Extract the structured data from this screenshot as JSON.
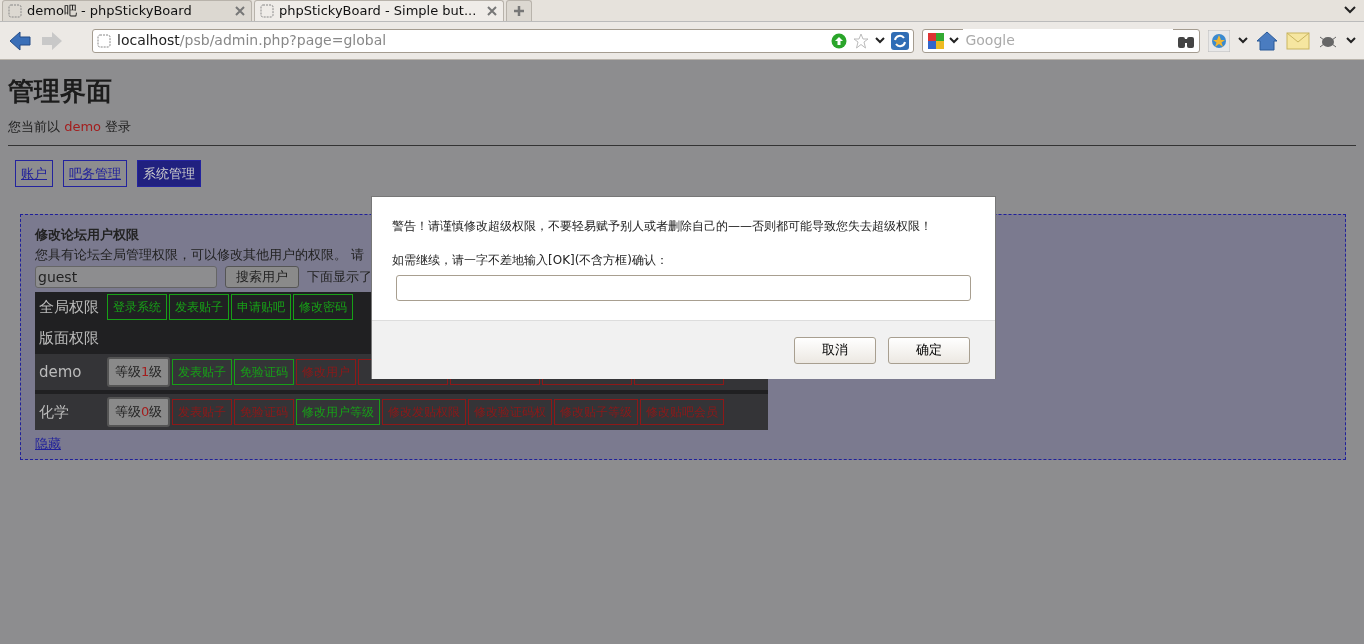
{
  "browser": {
    "tabs": [
      {
        "title": "demo吧 - phpStickyBoard",
        "selected": false
      },
      {
        "title": "phpStickyBoard - Simple but...",
        "selected": true
      }
    ],
    "url": {
      "host": "localhost",
      "path": "/psb/admin.php?page=global"
    },
    "search": {
      "placeholder": "Google"
    }
  },
  "page": {
    "title": "管理界面",
    "login": {
      "prefix": "您当前以",
      "user": "demo",
      "suffix": "登录"
    },
    "nav": [
      {
        "label": "账户",
        "selected": false
      },
      {
        "label": "吧务管理",
        "selected": false
      },
      {
        "label": "系统管理",
        "selected": true
      }
    ],
    "panel": {
      "title": "修改论坛用户权限",
      "description": "您具有论坛全局管理权限，可以修改其他用户的权限。 请",
      "search": {
        "value": "guest",
        "button": "搜索用户"
      },
      "note": "下面显示了",
      "global": {
        "label": "全局权限",
        "cells": [
          {
            "label": "登录系统",
            "granted": true
          },
          {
            "label": "发表贴子",
            "granted": true
          },
          {
            "label": "申请贴吧",
            "granted": true
          },
          {
            "label": "修改密码",
            "granted": true
          }
        ]
      },
      "board_header": "版面权限",
      "users": [
        {
          "name": "demo",
          "grade_prefix": "等级",
          "grade": "1",
          "grade_suffix": "级",
          "cells": [
            {
              "label": "发表贴子",
              "granted": true
            },
            {
              "label": "免验证码",
              "granted": true
            },
            {
              "label": "修改用户",
              "granted": false
            },
            {
              "granted": false
            },
            {
              "granted": false
            },
            {
              "granted": false
            },
            {
              "granted": false
            }
          ]
        },
        {
          "name": "化学",
          "grade_prefix": "等级",
          "grade": "0",
          "grade_suffix": "级",
          "cells": [
            {
              "label": "发表贴子",
              "granted": false
            },
            {
              "label": "免验证码",
              "granted": false
            },
            {
              "label": "修改用户等级",
              "granted": true
            },
            {
              "label": "修改发贴权限",
              "granted": false
            },
            {
              "label": "修改验证码权",
              "granted": false
            },
            {
              "label": "修改贴子等级",
              "granted": false
            },
            {
              "label": "修改贴吧会员",
              "granted": false
            }
          ]
        }
      ],
      "hide_link": "隐藏"
    }
  },
  "dialog": {
    "warning": "警告！请谨慎修改超级权限，不要轻易赋予别人或者删除自己的——否则都可能导致您失去超级权限！",
    "prompt": "如需继续，请一字不差地输入[OK](不含方框)确认：",
    "buttons": [
      "取消",
      "确定"
    ]
  }
}
